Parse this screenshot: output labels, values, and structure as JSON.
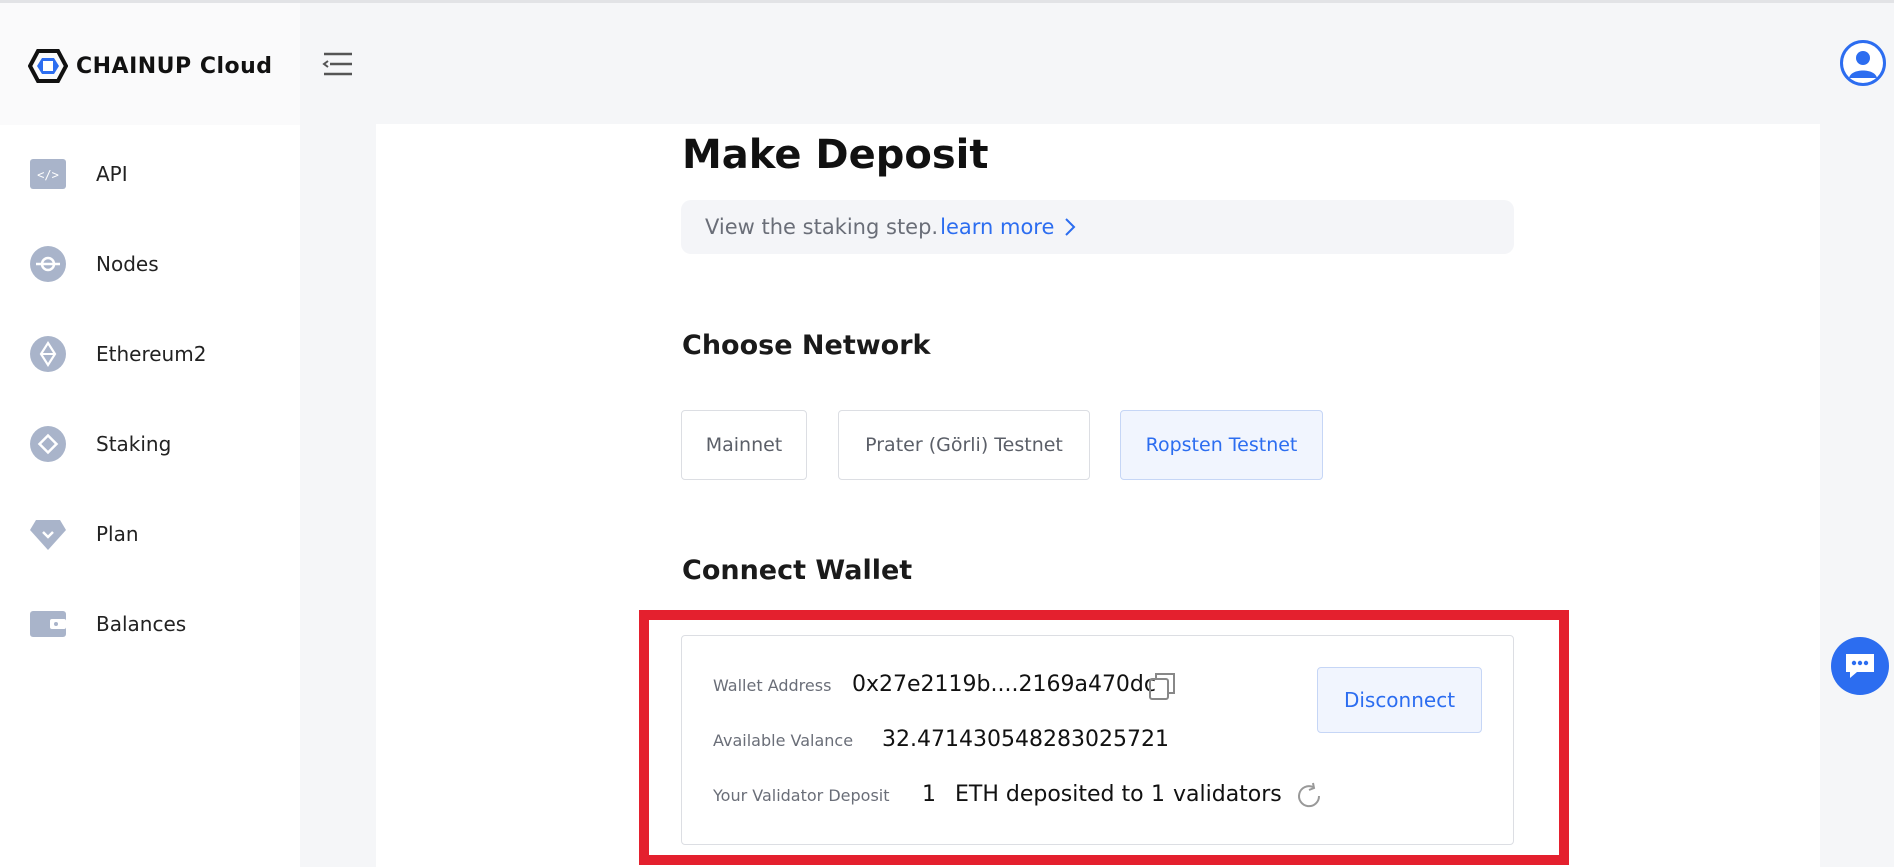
{
  "brand": {
    "name": "CHAINUP Cloud"
  },
  "sidebar": {
    "items": [
      {
        "label": "API",
        "icon": "code-icon"
      },
      {
        "label": "Nodes",
        "icon": "node-icon"
      },
      {
        "label": "Ethereum2",
        "icon": "ethereum-icon"
      },
      {
        "label": "Staking",
        "icon": "staking-icon"
      },
      {
        "label": "Plan",
        "icon": "diamond-icon"
      },
      {
        "label": "Balances",
        "icon": "wallet-icon"
      }
    ]
  },
  "page": {
    "title": "Make Deposit",
    "info_text": "View the staking step.",
    "learn_more": "learn more"
  },
  "network": {
    "title": "Choose Network",
    "options": [
      "Mainnet",
      "Prater (Görli) Testnet",
      "Ropsten Testnet"
    ],
    "selected": "Ropsten Testnet"
  },
  "wallet": {
    "title": "Connect Wallet",
    "address_label": "Wallet Address",
    "address_value": "0x27e2119b....2169a470dc",
    "balance_label": "Available Valance",
    "balance_value": "32.471430548283025721",
    "deposit_label": "Your Validator Deposit",
    "deposit_amount": "1",
    "deposit_text_1": "ETH deposited to",
    "deposit_validators": "1",
    "deposit_text_2": "validators",
    "disconnect_label": "Disconnect"
  },
  "colors": {
    "accent": "#2c6df0",
    "highlight": "#e4202e",
    "icon_gray": "#a9b4ca"
  }
}
